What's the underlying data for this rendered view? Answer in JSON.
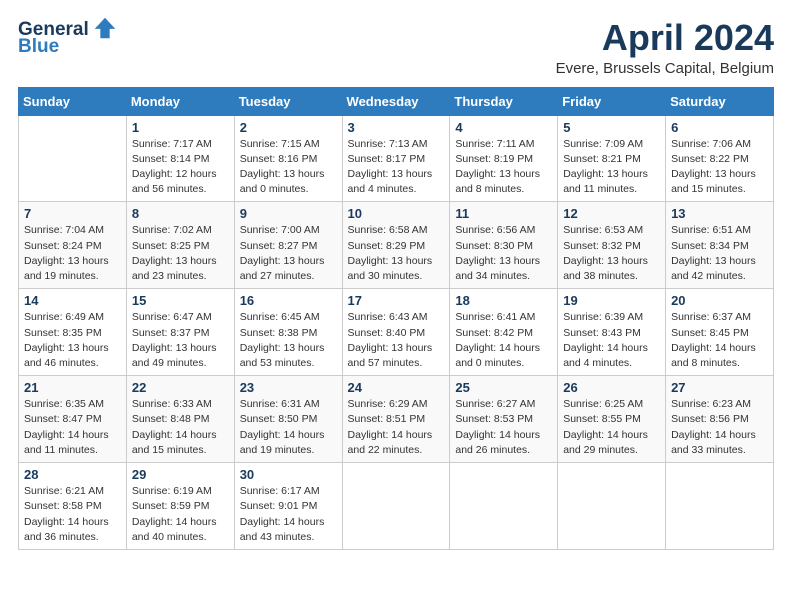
{
  "header": {
    "logo_general": "General",
    "logo_blue": "Blue",
    "title": "April 2024",
    "subtitle": "Evere, Brussels Capital, Belgium"
  },
  "weekdays": [
    "Sunday",
    "Monday",
    "Tuesday",
    "Wednesday",
    "Thursday",
    "Friday",
    "Saturday"
  ],
  "weeks": [
    [
      {
        "day": "",
        "info": ""
      },
      {
        "day": "1",
        "info": "Sunrise: 7:17 AM\nSunset: 8:14 PM\nDaylight: 12 hours\nand 56 minutes."
      },
      {
        "day": "2",
        "info": "Sunrise: 7:15 AM\nSunset: 8:16 PM\nDaylight: 13 hours\nand 0 minutes."
      },
      {
        "day": "3",
        "info": "Sunrise: 7:13 AM\nSunset: 8:17 PM\nDaylight: 13 hours\nand 4 minutes."
      },
      {
        "day": "4",
        "info": "Sunrise: 7:11 AM\nSunset: 8:19 PM\nDaylight: 13 hours\nand 8 minutes."
      },
      {
        "day": "5",
        "info": "Sunrise: 7:09 AM\nSunset: 8:21 PM\nDaylight: 13 hours\nand 11 minutes."
      },
      {
        "day": "6",
        "info": "Sunrise: 7:06 AM\nSunset: 8:22 PM\nDaylight: 13 hours\nand 15 minutes."
      }
    ],
    [
      {
        "day": "7",
        "info": "Sunrise: 7:04 AM\nSunset: 8:24 PM\nDaylight: 13 hours\nand 19 minutes."
      },
      {
        "day": "8",
        "info": "Sunrise: 7:02 AM\nSunset: 8:25 PM\nDaylight: 13 hours\nand 23 minutes."
      },
      {
        "day": "9",
        "info": "Sunrise: 7:00 AM\nSunset: 8:27 PM\nDaylight: 13 hours\nand 27 minutes."
      },
      {
        "day": "10",
        "info": "Sunrise: 6:58 AM\nSunset: 8:29 PM\nDaylight: 13 hours\nand 30 minutes."
      },
      {
        "day": "11",
        "info": "Sunrise: 6:56 AM\nSunset: 8:30 PM\nDaylight: 13 hours\nand 34 minutes."
      },
      {
        "day": "12",
        "info": "Sunrise: 6:53 AM\nSunset: 8:32 PM\nDaylight: 13 hours\nand 38 minutes."
      },
      {
        "day": "13",
        "info": "Sunrise: 6:51 AM\nSunset: 8:34 PM\nDaylight: 13 hours\nand 42 minutes."
      }
    ],
    [
      {
        "day": "14",
        "info": "Sunrise: 6:49 AM\nSunset: 8:35 PM\nDaylight: 13 hours\nand 46 minutes."
      },
      {
        "day": "15",
        "info": "Sunrise: 6:47 AM\nSunset: 8:37 PM\nDaylight: 13 hours\nand 49 minutes."
      },
      {
        "day": "16",
        "info": "Sunrise: 6:45 AM\nSunset: 8:38 PM\nDaylight: 13 hours\nand 53 minutes."
      },
      {
        "day": "17",
        "info": "Sunrise: 6:43 AM\nSunset: 8:40 PM\nDaylight: 13 hours\nand 57 minutes."
      },
      {
        "day": "18",
        "info": "Sunrise: 6:41 AM\nSunset: 8:42 PM\nDaylight: 14 hours\nand 0 minutes."
      },
      {
        "day": "19",
        "info": "Sunrise: 6:39 AM\nSunset: 8:43 PM\nDaylight: 14 hours\nand 4 minutes."
      },
      {
        "day": "20",
        "info": "Sunrise: 6:37 AM\nSunset: 8:45 PM\nDaylight: 14 hours\nand 8 minutes."
      }
    ],
    [
      {
        "day": "21",
        "info": "Sunrise: 6:35 AM\nSunset: 8:47 PM\nDaylight: 14 hours\nand 11 minutes."
      },
      {
        "day": "22",
        "info": "Sunrise: 6:33 AM\nSunset: 8:48 PM\nDaylight: 14 hours\nand 15 minutes."
      },
      {
        "day": "23",
        "info": "Sunrise: 6:31 AM\nSunset: 8:50 PM\nDaylight: 14 hours\nand 19 minutes."
      },
      {
        "day": "24",
        "info": "Sunrise: 6:29 AM\nSunset: 8:51 PM\nDaylight: 14 hours\nand 22 minutes."
      },
      {
        "day": "25",
        "info": "Sunrise: 6:27 AM\nSunset: 8:53 PM\nDaylight: 14 hours\nand 26 minutes."
      },
      {
        "day": "26",
        "info": "Sunrise: 6:25 AM\nSunset: 8:55 PM\nDaylight: 14 hours\nand 29 minutes."
      },
      {
        "day": "27",
        "info": "Sunrise: 6:23 AM\nSunset: 8:56 PM\nDaylight: 14 hours\nand 33 minutes."
      }
    ],
    [
      {
        "day": "28",
        "info": "Sunrise: 6:21 AM\nSunset: 8:58 PM\nDaylight: 14 hours\nand 36 minutes."
      },
      {
        "day": "29",
        "info": "Sunrise: 6:19 AM\nSunset: 8:59 PM\nDaylight: 14 hours\nand 40 minutes."
      },
      {
        "day": "30",
        "info": "Sunrise: 6:17 AM\nSunset: 9:01 PM\nDaylight: 14 hours\nand 43 minutes."
      },
      {
        "day": "",
        "info": ""
      },
      {
        "day": "",
        "info": ""
      },
      {
        "day": "",
        "info": ""
      },
      {
        "day": "",
        "info": ""
      }
    ]
  ]
}
